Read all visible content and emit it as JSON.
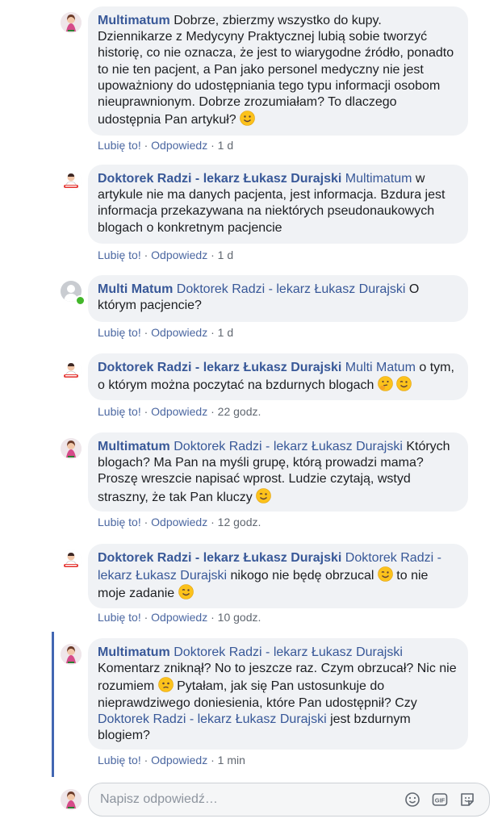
{
  "colors": {
    "author": "#385898",
    "link": "#4b67a1",
    "bubble": "#f0f2f5",
    "thread_bar": "#4267b2",
    "online": "#42b72a"
  },
  "comments": [
    {
      "author": "Multimatum",
      "avatar": "woman-avatar",
      "text_parts": [
        {
          "t": " Dobrze, zbierzmy wszystko do kupy. Dziennikarze z Medycyny Praktycznej lubią sobie tworzyć historię, co nie oznacza, że jest to wiarygodne źródło, ponadto to nie ten pacjent, a Pan jako personel medyczny nie jest upoważniony do udostępniania tego typu informacji osobom nieuprawnionym. Dobrze zrozumiałam? To dlaczego udostępnia Pan artykuł? "
        }
      ],
      "like": "Lubię to!",
      "reply": "Odpowiedz",
      "time": "1 d"
    },
    {
      "author": "Doktorek Radzi - lekarz Łukasz Durajski",
      "avatar": "doctor-avatar",
      "mention": "Multimatum",
      "text": " w artykule nie ma danych pacjenta, jest informacja. Bzdura jest informacja przekazywana na niektórych pseudonaukowych blogach o konkretnym pacjencie",
      "like": "Lubię to!",
      "reply": "Odpowiedz",
      "time": "1 d"
    },
    {
      "author": "Multi Matum",
      "avatar": "default-avatar",
      "mention": "Doktorek Radzi - lekarz Łukasz Durajski",
      "text": " O którym pacjencie?",
      "like": "Lubię to!",
      "reply": "Odpowiedz",
      "time": "1 d"
    },
    {
      "author": "Doktorek Radzi - lekarz Łukasz Durajski",
      "avatar": "doctor-avatar",
      "mention": "Multi Matum",
      "text": " o tym, o którym można poczytać na bzdurnych blogach ",
      "like": "Lubię to!",
      "reply": "Odpowiedz",
      "time": "22 godz."
    },
    {
      "author": "Multimatum",
      "avatar": "woman-avatar",
      "mention": "Doktorek Radzi - lekarz Łukasz Durajski",
      "text": " Których blogach? Ma Pan na myśli grupę, którą prowadzi mama? Proszę wreszcie napisać wprost. Ludzie czytają, wstyd straszny, że tak Pan kluczy ",
      "like": "Lubię to!",
      "reply": "Odpowiedz",
      "time": "12 godz."
    },
    {
      "author": "Doktorek Radzi - lekarz Łukasz Durajski",
      "avatar": "doctor-avatar",
      "mention": "Doktorek Radzi - lekarz Łukasz Durajski",
      "text1": " nikogo nie będę obrzucal ",
      "text2": " to nie moje zadanie ",
      "like": "Lubię to!",
      "reply": "Odpowiedz",
      "time": "10 godz."
    },
    {
      "author": "Multimatum",
      "avatar": "woman-avatar",
      "mention": "Doktorek Radzi - lekarz Łukasz Durajski",
      "text1": "Komentarz zniknął? No to jeszcze raz. Czym obrzucał? Nic nie rozumiem ",
      "text2": " Pytałam, jak się Pan ustosunkuje do nieprawdziwego doniesienia, które Pan udostępnił? Czy ",
      "mention2": "Doktorek Radzi - lekarz Łukasz Durajski",
      "text3": " jest bzdurnym blogiem?",
      "like": "Lubię to!",
      "reply": "Odpowiedz",
      "time": "1 min"
    }
  ],
  "reply_input": {
    "placeholder": "Napisz odpowiedź…"
  },
  "reply_icons": [
    "emoji-icon",
    "gif-icon",
    "sticker-icon"
  ]
}
